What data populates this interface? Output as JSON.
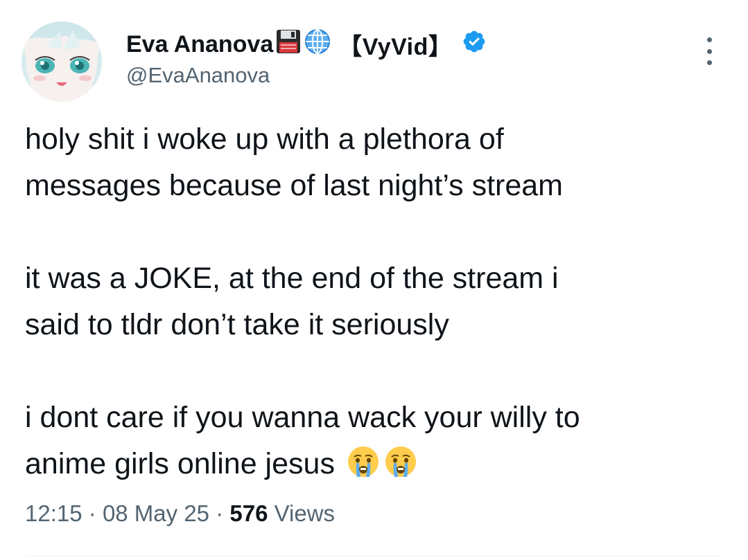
{
  "tweet": {
    "author": {
      "display_name": "Eva Ananova",
      "name_suffix": "【VyVid】",
      "emojis": [
        "floppy-disk-icon",
        "globe-icon"
      ],
      "handle": "@EvaAnanova",
      "verified": true
    },
    "paragraphs": [
      [
        "holy shit i woke up with a plethora of",
        "messages because of last night’s stream"
      ],
      [
        "it was a JOKE, at the end of the stream i",
        "said to tldr don’t take it seriously"
      ],
      [
        "i dont care if you wanna wack your willy to",
        "anime girls online jesus"
      ]
    ],
    "trailing_emojis": [
      "crying-face-icon",
      "crying-face-icon"
    ],
    "time": "12:15",
    "date": "08 May 25",
    "separator": "·",
    "views_count": "576",
    "views_label": "Views"
  },
  "colors": {
    "text_primary": "#0f1419",
    "text_secondary": "#536471",
    "verified_blue": "#1d9bf0",
    "divider": "#eff3f4"
  }
}
